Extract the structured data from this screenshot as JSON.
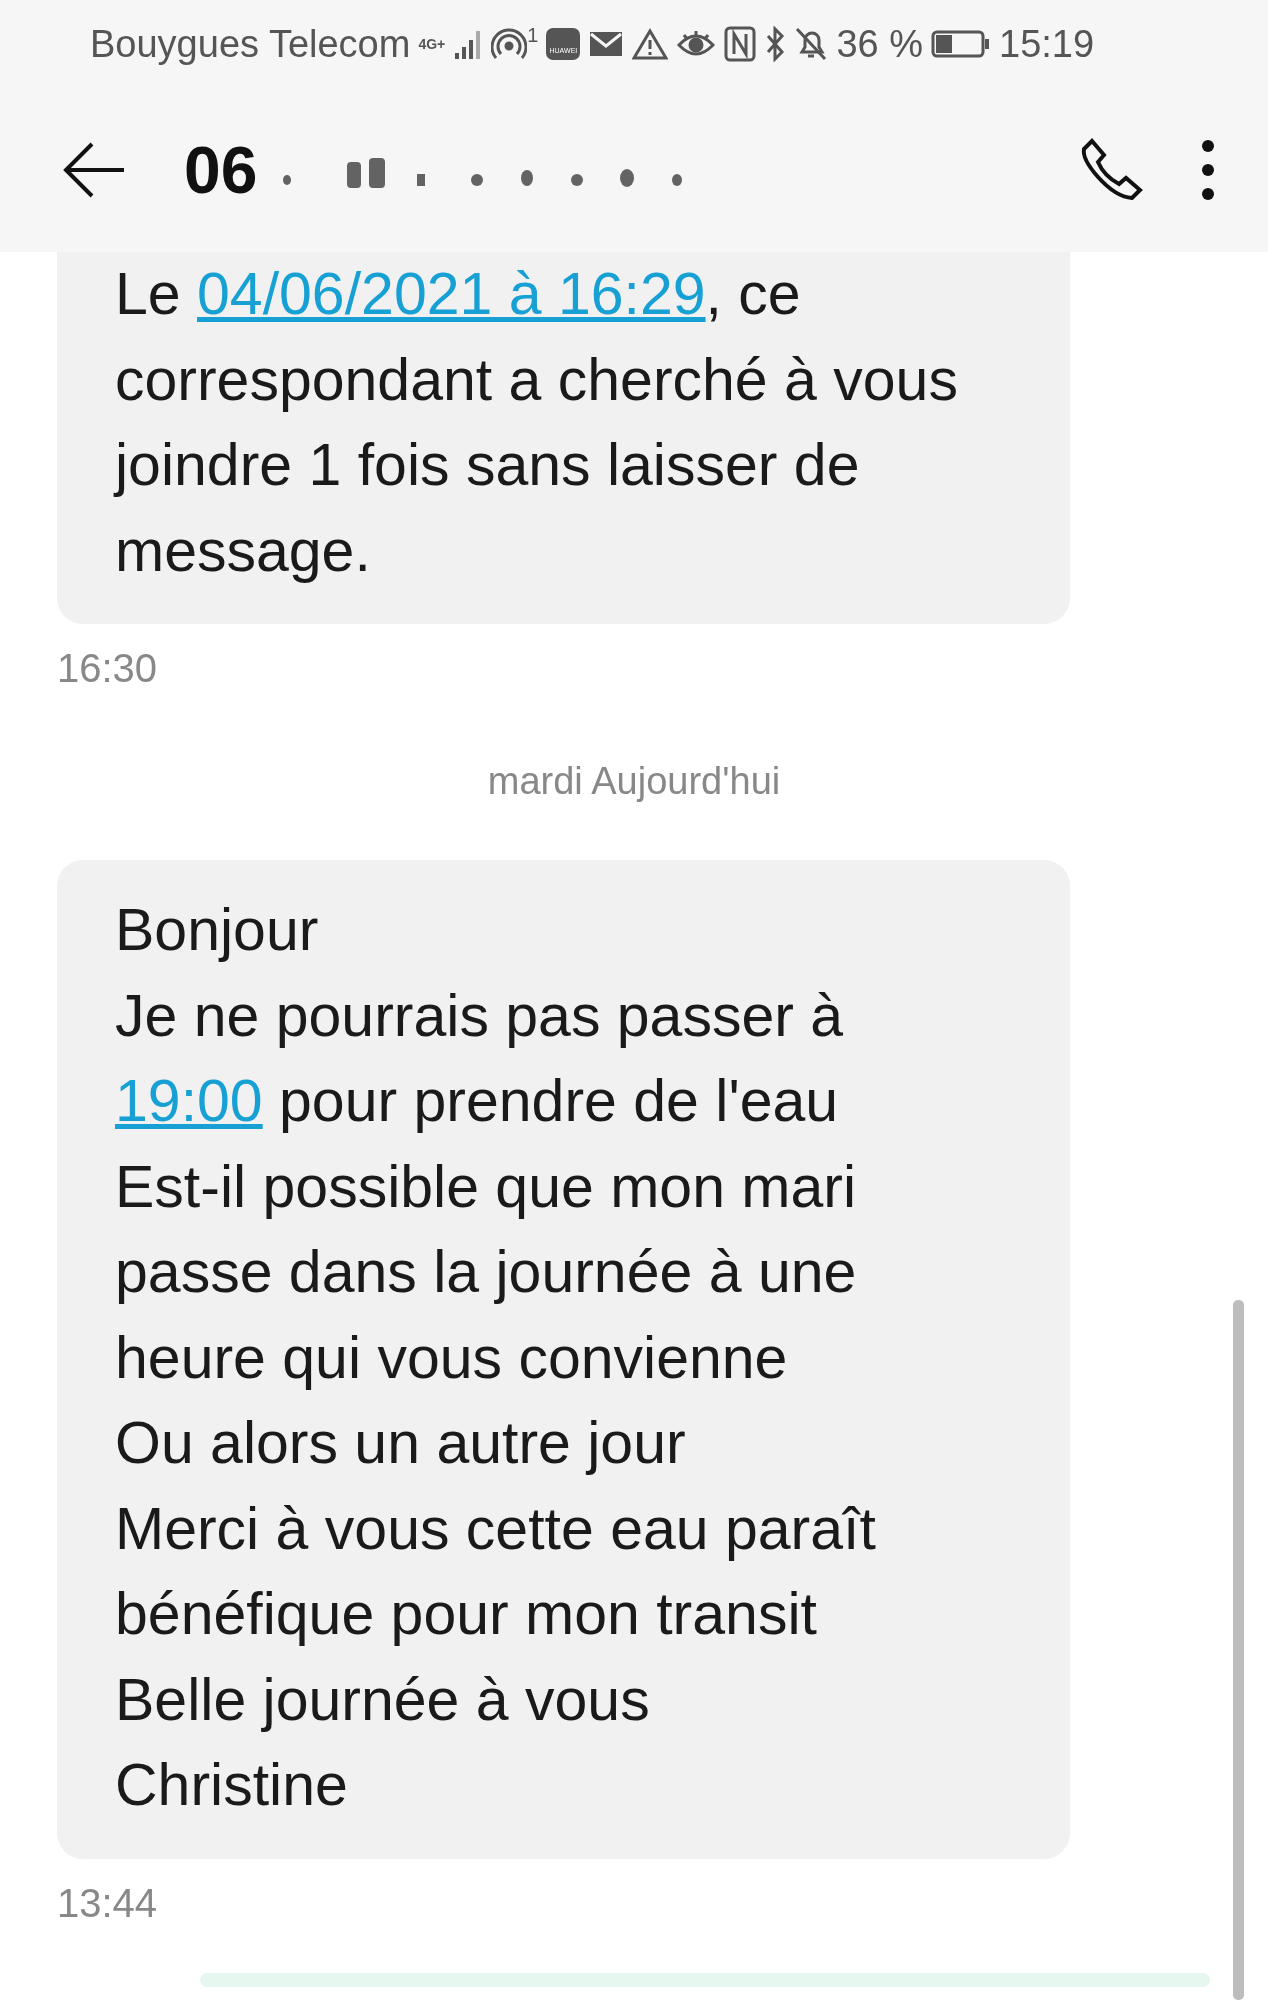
{
  "status_bar": {
    "carrier": "Bouygues Telecom",
    "network": "4G+",
    "hotspot_count": "1",
    "app_badge": "HUAWEI",
    "battery": "36 %",
    "time": "15:19"
  },
  "header": {
    "title": "06"
  },
  "thread": [
    {
      "kind": "message",
      "cut_top": true,
      "parts": [
        {
          "kind": "text",
          "text": "Le "
        },
        {
          "kind": "link",
          "text": "04/06/2021 à 16:29"
        },
        {
          "kind": "text",
          "text": ", ce correspondant a cherché à vous joindre 1 fois sans laisser de message."
        }
      ]
    },
    {
      "kind": "time",
      "text": "16:30"
    },
    {
      "kind": "date",
      "text": "mardi Aujourd'hui"
    },
    {
      "kind": "message",
      "cut_top": false,
      "parts": [
        {
          "kind": "text",
          "text": "Bonjour\nJe ne pourrais pas passer à\n"
        },
        {
          "kind": "link",
          "text": "19:00"
        },
        {
          "kind": "text",
          "text": " pour prendre de l'eau\nEst-il possible que mon mari passe dans la journée à une heure qui vous convienne\nOu alors un autre jour\nMerci à vous cette eau paraît bénéfique pour mon transit\nBelle journée à vous\nChristine"
        }
      ]
    },
    {
      "kind": "time",
      "text": "13:44"
    },
    {
      "kind": "outgoing"
    }
  ]
}
